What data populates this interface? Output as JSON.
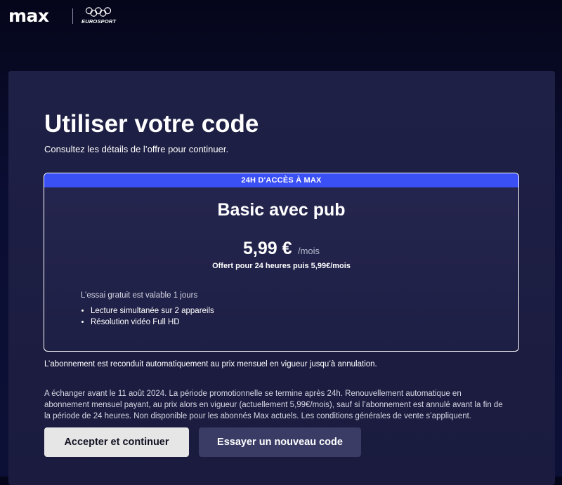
{
  "header": {
    "logo_text": "max",
    "partner_text": "EUROSPORT",
    "partner_icon": "olympic-rings-icon"
  },
  "main": {
    "title": "Utiliser votre code",
    "subtitle": "Consultez les détails de l’offre pour continuer."
  },
  "offer": {
    "banner": "24H D'ACCÈS À MAX",
    "plan_name": "Basic avec pub",
    "price": "5,99 €",
    "price_period": "/mois",
    "note": "Offert pour 24 heures puis 5,99€/mois",
    "trial_text": "L’essai gratuit est valable 1 jours",
    "features": [
      "Lecture simultanée sur 2 appareils",
      "Résolution vidéo Full HD"
    ],
    "colors": {
      "banner": "#3a4ff4",
      "border": "#ffffff"
    }
  },
  "renewal_text": "L’abonnement est reconduit automatiquement au prix mensuel en vigueur jusqu’à annulation.",
  "legal_text": "A échanger avant le 11 août 2024. La période promotionnelle se termine après 24h. Renouvellement automatique en abonnement mensuel payant, au prix alors en vigueur (actuellement 5,99€/mois), sauf si l’abonnement est annulé avant la fin de la période de 24 heures. Non disponible pour les abonnés Max actuels. Les conditions générales de vente s’appliquent.",
  "buttons": {
    "accept": "Accepter et continuer",
    "retry": "Essayer un nouveau code"
  }
}
